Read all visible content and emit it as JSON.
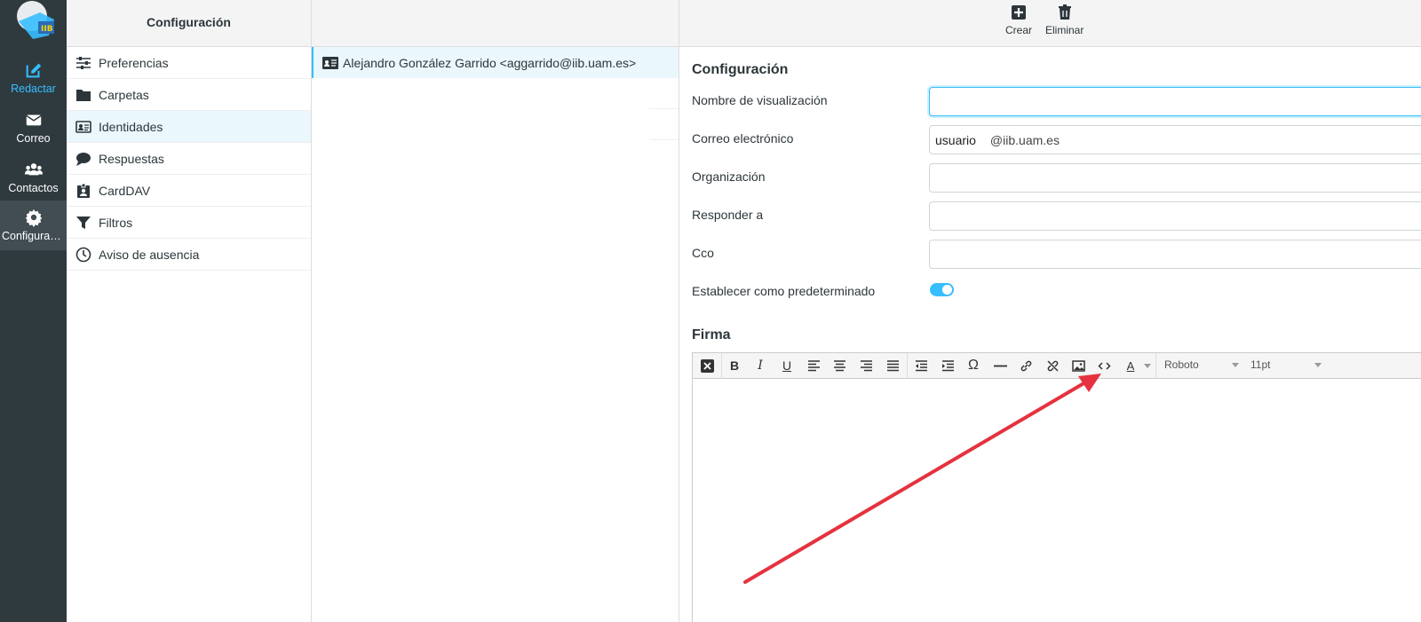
{
  "nav": {
    "items": [
      {
        "label": "Redactar",
        "icon": "compose-icon"
      },
      {
        "label": "Correo",
        "icon": "envelope-icon"
      },
      {
        "label": "Contactos",
        "icon": "users-icon"
      },
      {
        "label": "Configuraci...",
        "icon": "gear-icon"
      }
    ]
  },
  "settings": {
    "title": "Configuración",
    "items": [
      {
        "label": "Preferencias",
        "icon": "sliders-icon"
      },
      {
        "label": "Carpetas",
        "icon": "folder-icon"
      },
      {
        "label": "Identidades",
        "icon": "id-card-icon"
      },
      {
        "label": "Respuestas",
        "icon": "comment-icon"
      },
      {
        "label": "CardDAV",
        "icon": "contact-card-icon"
      },
      {
        "label": "Filtros",
        "icon": "filter-icon"
      },
      {
        "label": "Aviso de ausencia",
        "icon": "clock-icon"
      }
    ]
  },
  "identities": {
    "items": [
      {
        "label": "Alejandro González Garrido <aggarrido@iib.uam.es>"
      }
    ]
  },
  "toolbar": {
    "create_label": "Crear",
    "delete_label": "Eliminar"
  },
  "form": {
    "section_title": "Configuración",
    "display_name_label": "Nombre de visualización",
    "display_name_value": "",
    "email_label": "Correo electrónico",
    "email_user": "usuario",
    "email_domain": "@iib.uam.es",
    "org_label": "Organización",
    "org_value": "",
    "reply_label": "Responder a",
    "reply_value": "",
    "bcc_label": "Cco",
    "bcc_value": "",
    "default_label": "Establecer como predeterminado",
    "default_on": true
  },
  "signature": {
    "title": "Firma",
    "font": "Roboto",
    "size": "11pt"
  },
  "colors": {
    "accent": "#37beff",
    "nav_bg": "#2f3a3f",
    "arrow": "#e5323e"
  }
}
